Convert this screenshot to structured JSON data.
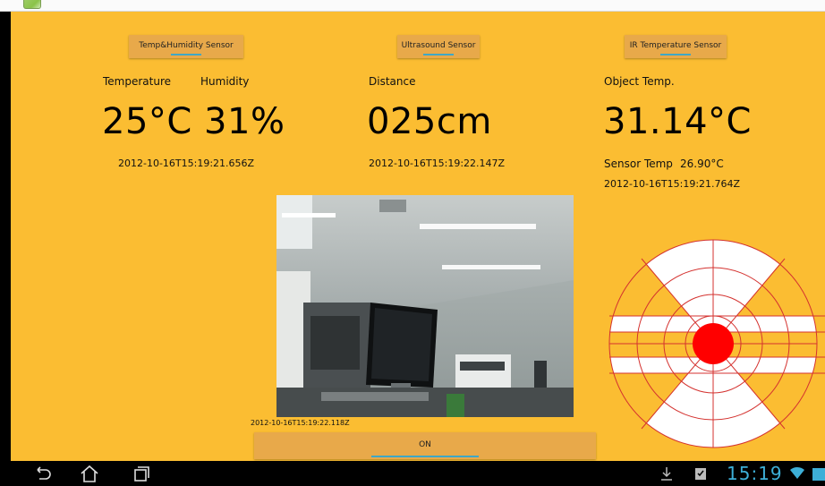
{
  "app": {
    "icon": "app-icon"
  },
  "sensors": {
    "temp_humidity": {
      "button_label": "Temp&Humidity Sensor",
      "label_temp": "Temperature",
      "label_humidity": "Humidity",
      "value": "25°C 31%",
      "timestamp": "2012-10-16T15:19:21.656Z"
    },
    "ultrasound": {
      "button_label": "Ultrasound Sensor",
      "label_distance": "Distance",
      "value": "025cm",
      "timestamp": "2012-10-16T15:19:22.147Z"
    },
    "ir": {
      "button_label": "IR Temperature Sensor",
      "label_object": "Object Temp.",
      "value": "31.14°C",
      "label_sensor": "Sensor Temp",
      "sensor_value": "26.90°C",
      "timestamp": "2012-10-16T15:19:21.764Z"
    }
  },
  "camera": {
    "timestamp": "2012-10-16T15:19:22.118Z",
    "toggle_label": "ON"
  },
  "status_bar": {
    "time": "15:19"
  },
  "colors": {
    "background": "#fbbd32",
    "button": "#e8a94a",
    "focus": "#3fa7c6",
    "radar_line": "#d4322f",
    "radar_center": "#ff0000",
    "clock": "#3dafd8"
  },
  "icons": {
    "nav_back": "back-icon",
    "nav_home": "home-icon",
    "nav_recent": "recent-apps-icon",
    "notif_download": "download-icon",
    "notif_task": "clipboard-check-icon",
    "wifi": "wifi-icon"
  }
}
